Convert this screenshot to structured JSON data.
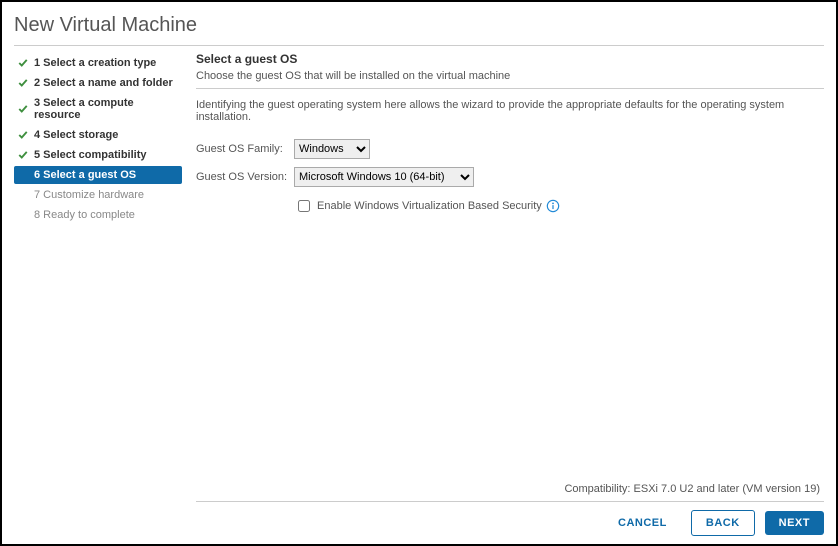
{
  "title": "New Virtual Machine",
  "sidebar": {
    "steps": [
      {
        "label": "1 Select a creation type",
        "status": "completed"
      },
      {
        "label": "2 Select a name and folder",
        "status": "completed"
      },
      {
        "label": "3 Select a compute resource",
        "status": "completed"
      },
      {
        "label": "4 Select storage",
        "status": "completed"
      },
      {
        "label": "5 Select compatibility",
        "status": "completed"
      },
      {
        "label": "6 Select a guest OS",
        "status": "current"
      },
      {
        "label": "7 Customize hardware",
        "status": "pending"
      },
      {
        "label": "8 Ready to complete",
        "status": "pending"
      }
    ]
  },
  "main": {
    "section_header": "Select a guest OS",
    "section_sub": "Choose the guest OS that will be installed on the virtual machine",
    "description": "Identifying the guest operating system here allows the wizard to provide the appropriate defaults for the operating system installation.",
    "family_label": "Guest OS Family:",
    "family_value": "Windows",
    "version_label": "Guest OS Version:",
    "version_value": "Microsoft Windows 10 (64-bit)",
    "vbscheck_label": "Enable Windows Virtualization Based Security",
    "compat": "Compatibility: ESXi 7.0 U2 and later (VM version 19)"
  },
  "footer": {
    "cancel": "CANCEL",
    "back": "BACK",
    "next": "NEXT"
  }
}
